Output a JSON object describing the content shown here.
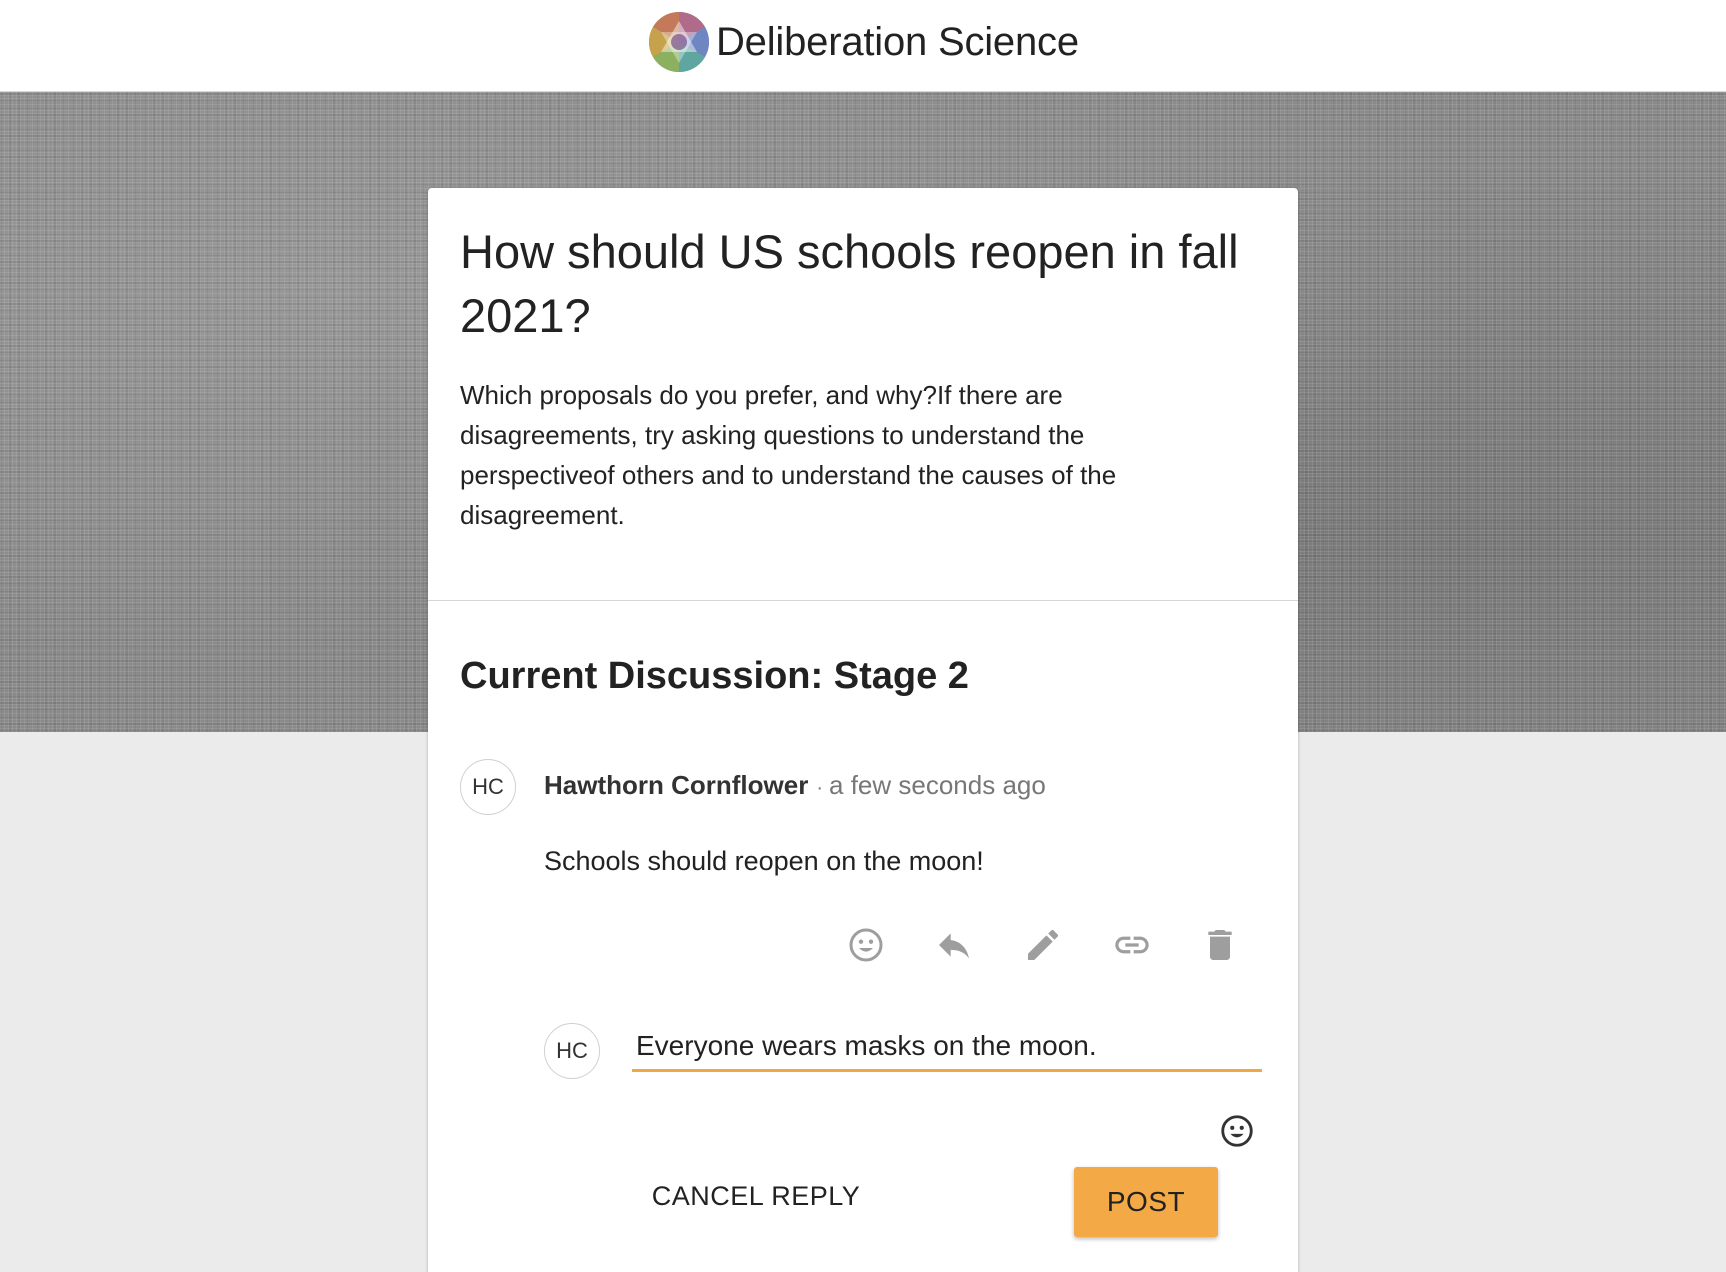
{
  "header": {
    "brand_name": "Deliberation Science",
    "logo_icon": "deliberation-science-logo"
  },
  "topic": {
    "title": "How should US schools reopen in fall 2021?",
    "prompt": "Which proposals do you prefer, and why?If there are disagreements, try asking questions to understand the perspectiveof others and to understand the causes of the disagreement."
  },
  "discussion": {
    "stage_title": "Current Discussion: Stage 2",
    "comment": {
      "avatar_initials": "HC",
      "author": "Hawthorn Cornflower",
      "separator": "·",
      "time": "a few seconds ago",
      "text": "Schools should reopen on the moon!",
      "actions": [
        {
          "name": "react",
          "icon": "smiley-icon"
        },
        {
          "name": "reply",
          "icon": "reply-arrow-icon"
        },
        {
          "name": "edit",
          "icon": "pencil-icon"
        },
        {
          "name": "link",
          "icon": "link-icon"
        },
        {
          "name": "delete",
          "icon": "trash-icon"
        }
      ]
    },
    "reply": {
      "avatar_initials": "HC",
      "input_value": "Everyone wears masks on the moon.",
      "emoji_icon": "smiley-icon",
      "cancel_label": "CANCEL REPLY",
      "post_label": "POST"
    }
  },
  "colors": {
    "accent": "#f2a946",
    "icon_gray": "#9e9e9e",
    "page_background": "#ebebeb",
    "hero_background": "#8a8a8a"
  }
}
